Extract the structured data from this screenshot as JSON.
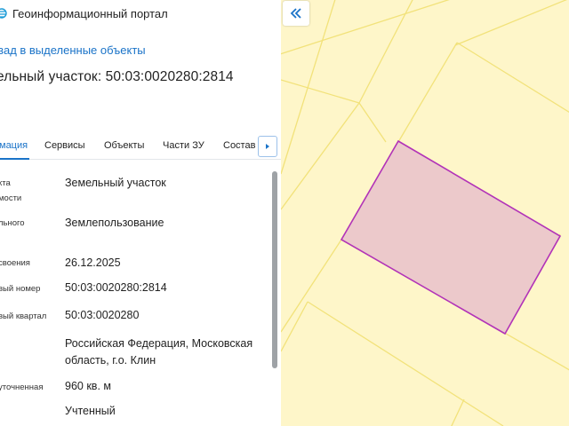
{
  "header": {
    "app_title": "Геоинформационный портал"
  },
  "back_link": "зад в выделенные объекты",
  "page_title": "ельный участок: 50:03:0020280:2814",
  "tabs": [
    {
      "label": "мация",
      "active": true
    },
    {
      "label": "Сервисы",
      "active": false
    },
    {
      "label": "Объекты",
      "active": false
    },
    {
      "label": "Части ЗУ",
      "active": false
    },
    {
      "label": "Состав",
      "active": false
    }
  ],
  "properties": [
    {
      "label_lines": [
        "кта",
        "мости"
      ],
      "value": "Земельный участок"
    },
    {
      "label_lines": [
        "льного",
        ""
      ],
      "value": "Землепользование"
    },
    {
      "label_lines": [
        "своения"
      ],
      "value": "26.12.2025"
    },
    {
      "label_lines": [
        "вый номер"
      ],
      "value": "50:03:0020280:2814"
    },
    {
      "label_lines": [
        "вый квартал"
      ],
      "value": "50:03:0020280"
    },
    {
      "label_lines": [
        ""
      ],
      "value": "Российская Федерация, Московская область, г.о. Клин"
    },
    {
      "label_lines": [
        "уточненная"
      ],
      "value": "960 кв. м"
    },
    {
      "label_lines": [
        ""
      ],
      "value": "Учтенный"
    }
  ],
  "colors": {
    "accent": "#1a73c8",
    "map_background": "#fef6c9",
    "parcel_lines": "#f2e27a",
    "selected_fill": "#ecc9cb",
    "selected_stroke": "#b233b8"
  },
  "icons": {
    "logo": "portal-logo-icon",
    "tab_scroll": "caret-right-icon",
    "collapse": "double-chevron-left-icon"
  }
}
